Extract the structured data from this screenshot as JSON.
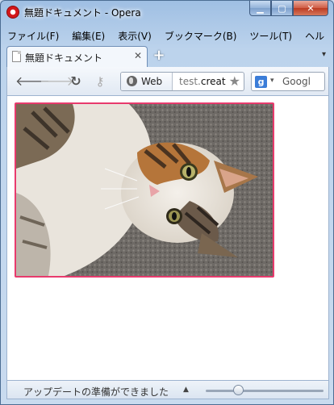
{
  "window": {
    "title": "無題ドキュメント - Opera",
    "minimize_glyph": "▁",
    "maximize_glyph": "▢",
    "close_glyph": "✕"
  },
  "menubar": {
    "items": [
      "ファイル(F)",
      "編集(E)",
      "表示(V)",
      "ブックマーク(B)",
      "ツール(T)",
      "ヘル"
    ]
  },
  "tabs": [
    {
      "label": "無題ドキュメント",
      "close_glyph": "✕",
      "active": true
    }
  ],
  "tabstrip": {
    "new_tab_glyph": "+",
    "tab_menu_glyph": "▾"
  },
  "toolbar": {
    "back_glyph": "🡐",
    "forward_glyph": "🡒",
    "reload_glyph": "↻",
    "key_glyph": "⚷",
    "security_label": "Web",
    "url_domain": "test.",
    "url_rest": "creat",
    "bookmark_glyph": "★",
    "search_engine_letter": "g",
    "search_dropdown_glyph": "▾",
    "search_placeholder": "Googl"
  },
  "content": {
    "image_subject": "cat-photo",
    "border_color": "#e83a6d"
  },
  "statusbar": {
    "text": "アップデートの準備ができました",
    "popup_glyph": "▲"
  }
}
